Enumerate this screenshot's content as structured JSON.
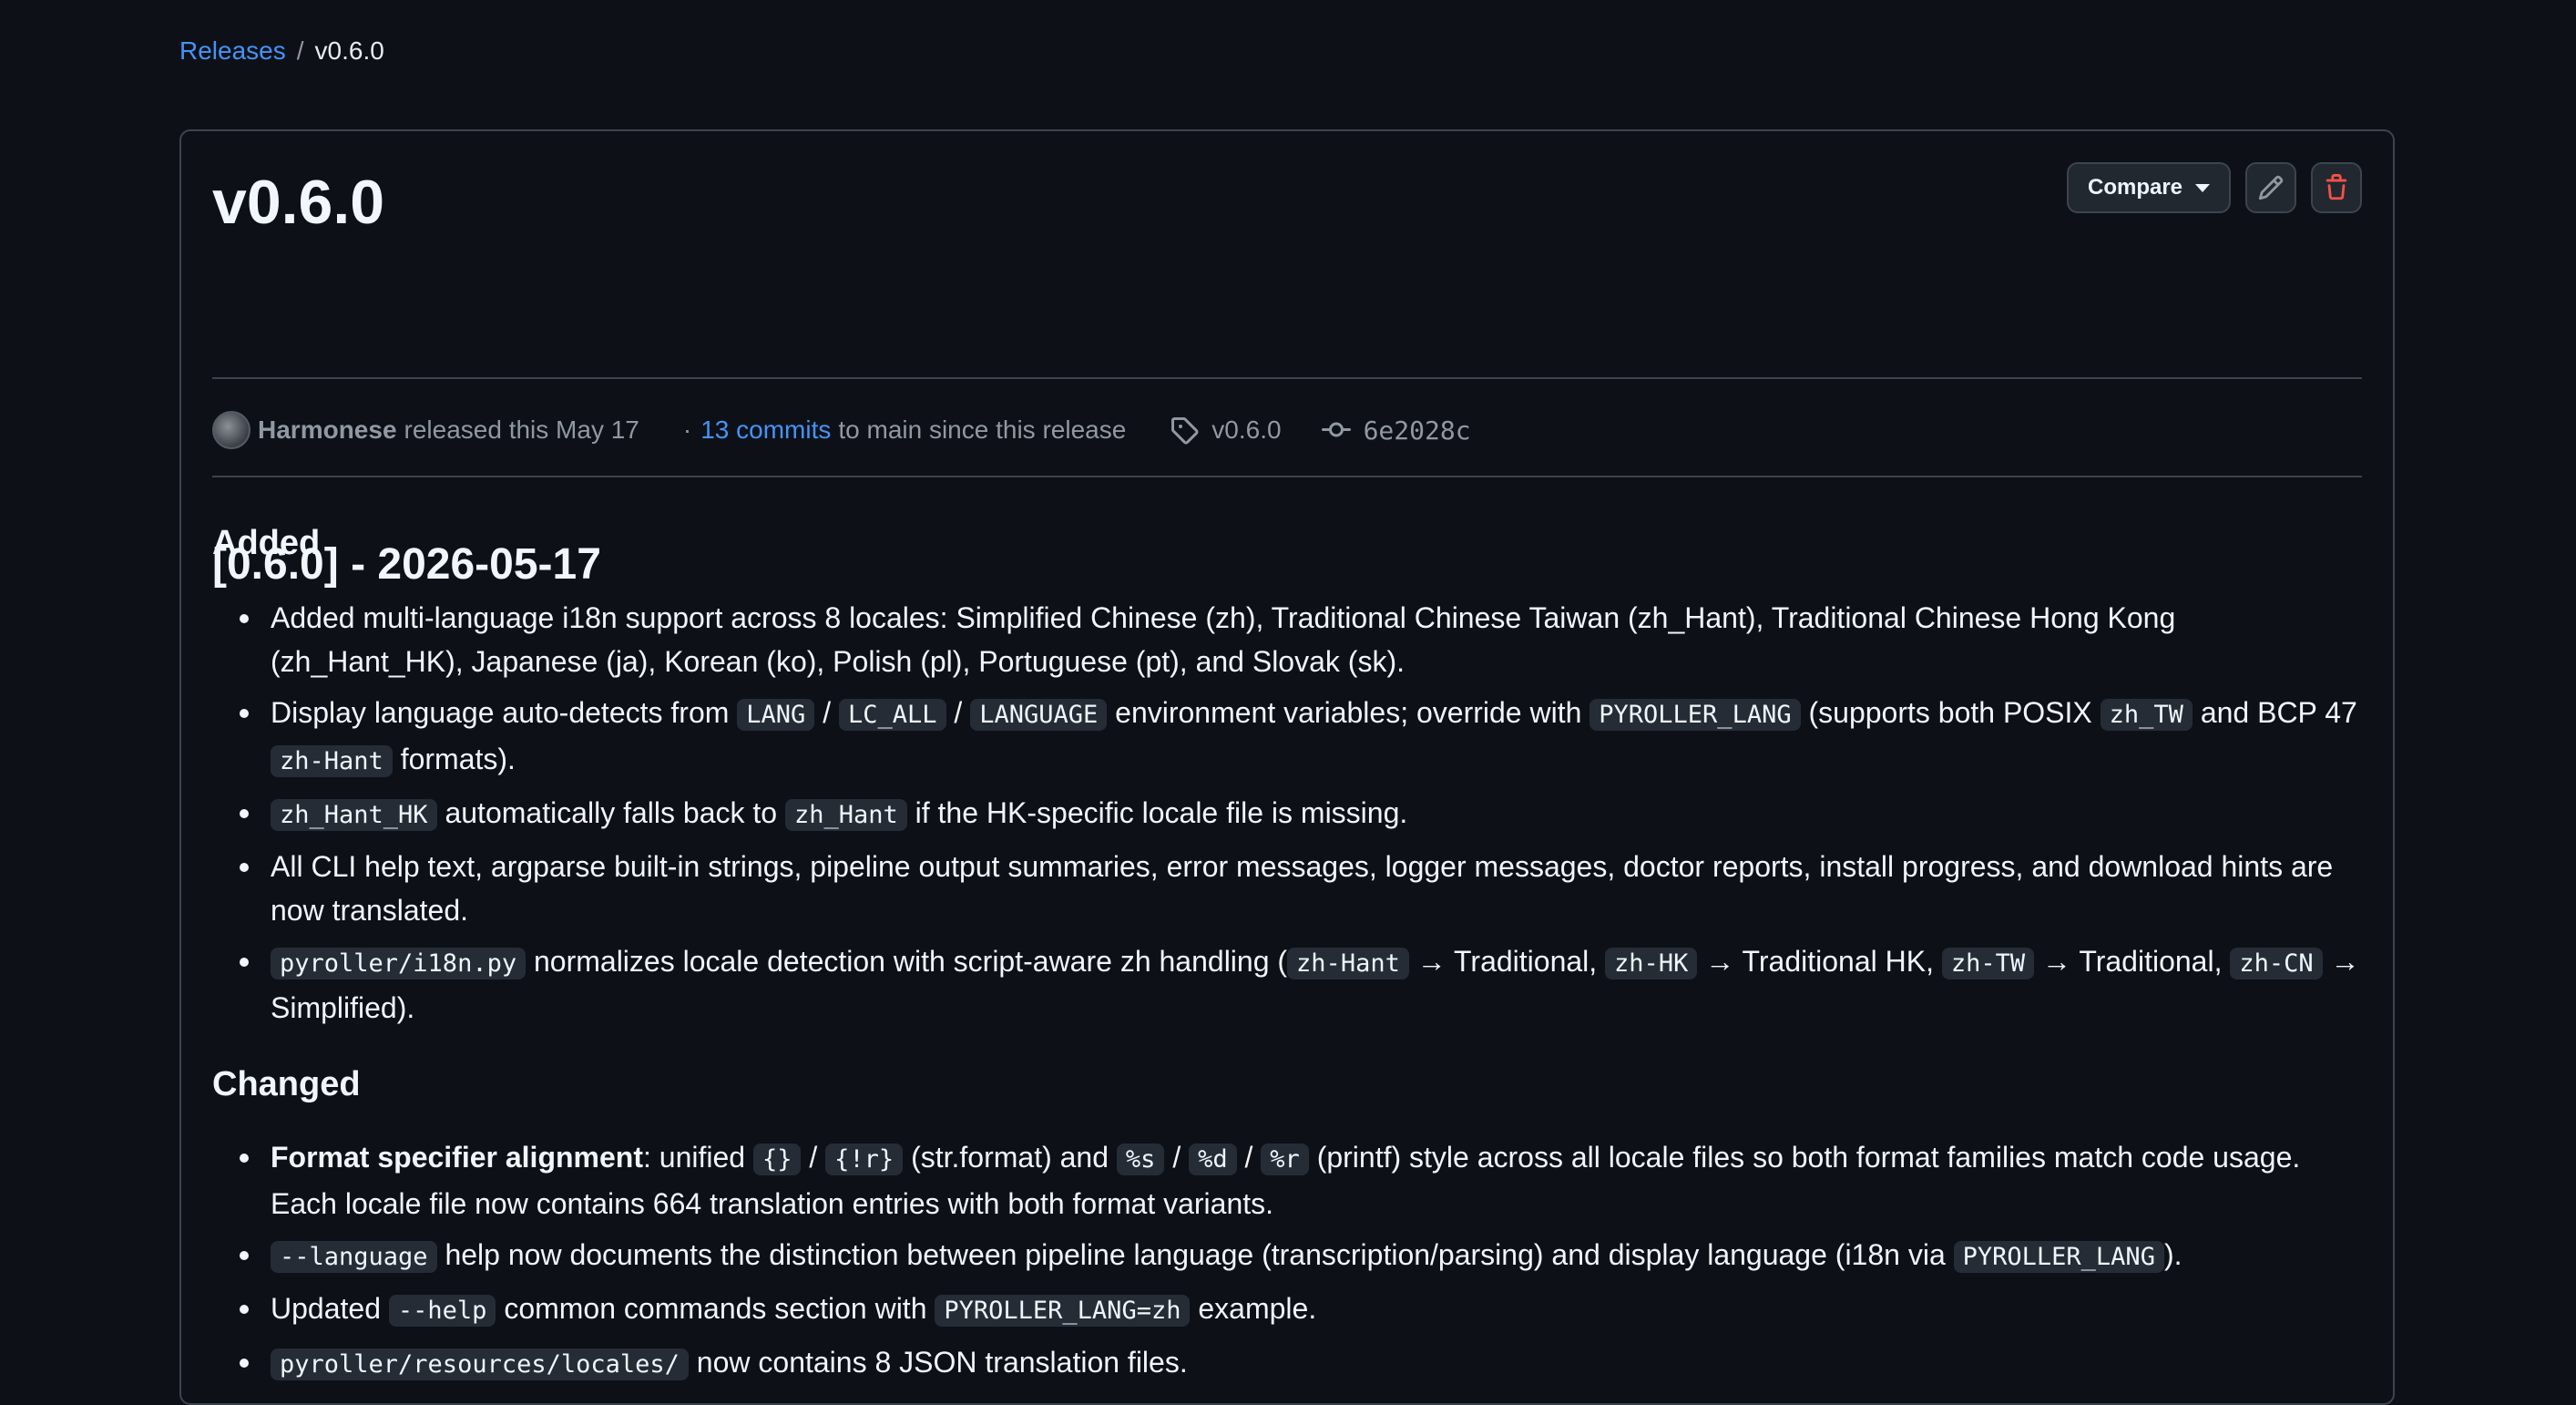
{
  "breadcrumb": {
    "parent": "Releases",
    "separator": "/",
    "current": "v0.6.0"
  },
  "release": {
    "title": "v0.6.0",
    "compare_label": "Compare",
    "author": "Harmonese",
    "released_text": "released this May 17",
    "dot": "·",
    "commits_link": "13 commits",
    "commits_suffix": "to main since this release",
    "tag": "v0.6.0",
    "commit_sha": "6e2028c"
  },
  "notes": {
    "heading": "[0.6.0] - 2026-05-17",
    "added": {
      "heading": "Added",
      "items": [
        {
          "parts": [
            {
              "t": "text",
              "v": "Added multi-language i18n support across 8 locales: Simplified Chinese (zh), Traditional Chinese Taiwan (zh_Hant), Traditional Chinese Hong Kong (zh_Hant_HK), Japanese (ja), Korean (ko), Polish (pl), Portuguese (pt), and Slovak (sk)."
            }
          ]
        },
        {
          "parts": [
            {
              "t": "text",
              "v": "Display language auto-detects from "
            },
            {
              "t": "code",
              "v": "LANG"
            },
            {
              "t": "text",
              "v": " / "
            },
            {
              "t": "code",
              "v": "LC_ALL"
            },
            {
              "t": "text",
              "v": " / "
            },
            {
              "t": "code",
              "v": "LANGUAGE"
            },
            {
              "t": "text",
              "v": " environment variables; override with "
            },
            {
              "t": "code",
              "v": "PYROLLER_LANG"
            },
            {
              "t": "text",
              "v": " (supports both POSIX "
            },
            {
              "t": "code",
              "v": "zh_TW"
            },
            {
              "t": "text",
              "v": " and BCP 47 "
            },
            {
              "t": "code",
              "v": "zh-Hant"
            },
            {
              "t": "text",
              "v": " formats)."
            }
          ]
        },
        {
          "parts": [
            {
              "t": "code",
              "v": "zh_Hant_HK"
            },
            {
              "t": "text",
              "v": " automatically falls back to "
            },
            {
              "t": "code",
              "v": "zh_Hant"
            },
            {
              "t": "text",
              "v": " if the HK-specific locale file is missing."
            }
          ]
        },
        {
          "parts": [
            {
              "t": "text",
              "v": "All CLI help text, argparse built-in strings, pipeline output summaries, error messages, logger messages, doctor reports, install progress, and download hints are now translated."
            }
          ]
        },
        {
          "parts": [
            {
              "t": "code",
              "v": "pyroller/i18n.py"
            },
            {
              "t": "text",
              "v": " normalizes locale detection with script-aware zh handling ("
            },
            {
              "t": "code",
              "v": "zh-Hant"
            },
            {
              "t": "text",
              "v": " → Traditional, "
            },
            {
              "t": "code",
              "v": "zh-HK"
            },
            {
              "t": "text",
              "v": " → Traditional HK, "
            },
            {
              "t": "code",
              "v": "zh-TW"
            },
            {
              "t": "text",
              "v": " → Traditional, "
            },
            {
              "t": "code",
              "v": "zh-CN"
            },
            {
              "t": "text",
              "v": " → Simplified)."
            }
          ]
        }
      ]
    },
    "changed": {
      "heading": "Changed",
      "items": [
        {
          "parts": [
            {
              "t": "bold",
              "v": "Format specifier alignment"
            },
            {
              "t": "text",
              "v": ": unified "
            },
            {
              "t": "code",
              "v": "{}"
            },
            {
              "t": "text",
              "v": " / "
            },
            {
              "t": "code",
              "v": "{!r}"
            },
            {
              "t": "text",
              "v": " (str.format) and "
            },
            {
              "t": "code",
              "v": "%s"
            },
            {
              "t": "text",
              "v": " / "
            },
            {
              "t": "code",
              "v": "%d"
            },
            {
              "t": "text",
              "v": " / "
            },
            {
              "t": "code",
              "v": "%r"
            },
            {
              "t": "text",
              "v": " (printf) style across all locale files so both format families match code usage. Each locale file now contains 664 translation entries with both format variants."
            }
          ]
        },
        {
          "parts": [
            {
              "t": "code",
              "v": "--language"
            },
            {
              "t": "text",
              "v": " help now documents the distinction between pipeline language (transcription/parsing) and display language (i18n via "
            },
            {
              "t": "code",
              "v": "PYROLLER_LANG"
            },
            {
              "t": "text",
              "v": ")."
            }
          ]
        },
        {
          "parts": [
            {
              "t": "text",
              "v": "Updated "
            },
            {
              "t": "code",
              "v": "--help"
            },
            {
              "t": "text",
              "v": " common commands section with "
            },
            {
              "t": "code",
              "v": "PYROLLER_LANG=zh"
            },
            {
              "t": "text",
              "v": " example."
            }
          ]
        },
        {
          "parts": [
            {
              "t": "code",
              "v": "pyroller/resources/locales/"
            },
            {
              "t": "text",
              "v": " now contains 8 JSON translation files."
            }
          ]
        }
      ]
    }
  }
}
